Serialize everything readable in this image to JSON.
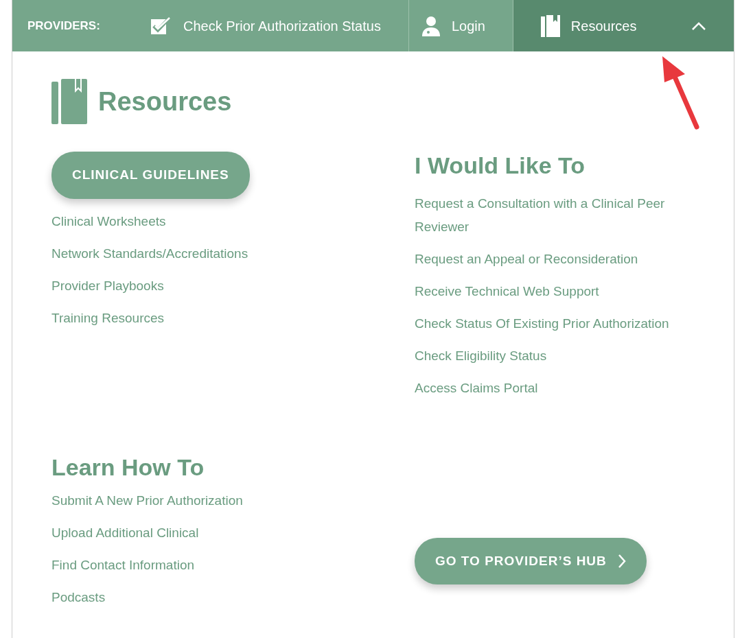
{
  "top_bar": {
    "label": "PROVIDERS:",
    "items": [
      {
        "label": "Check Prior Authorization Status",
        "kind": "check",
        "selected": false
      },
      {
        "label": "Login",
        "kind": "login",
        "selected": false
      },
      {
        "label": "Resources",
        "kind": "dropdown",
        "selected": true
      }
    ]
  },
  "menu": {
    "title": "Resources",
    "primary_button": "CLINICAL GUIDELINES",
    "resource_links": [
      "Clinical Worksheets",
      "Network Standards/Accreditations",
      "Provider Playbooks",
      "Training Resources"
    ],
    "learn": {
      "heading": "Learn How To",
      "links": [
        "Submit A New Prior Authorization",
        "Upload Additional Clinical",
        "Find Contact Information",
        "Podcasts"
      ]
    },
    "would_like": {
      "heading": "I Would Like To",
      "links": [
        "Request a Consultation with a Clinical Peer Reviewer",
        "Request an Appeal or Reconsideration",
        "Receive Technical Web Support",
        "Check Status Of Existing Prior Authorization",
        "Check Eligibility Status",
        "Access Claims Portal"
      ]
    },
    "hub_button": "GO TO PROVIDER’S HUB"
  }
}
